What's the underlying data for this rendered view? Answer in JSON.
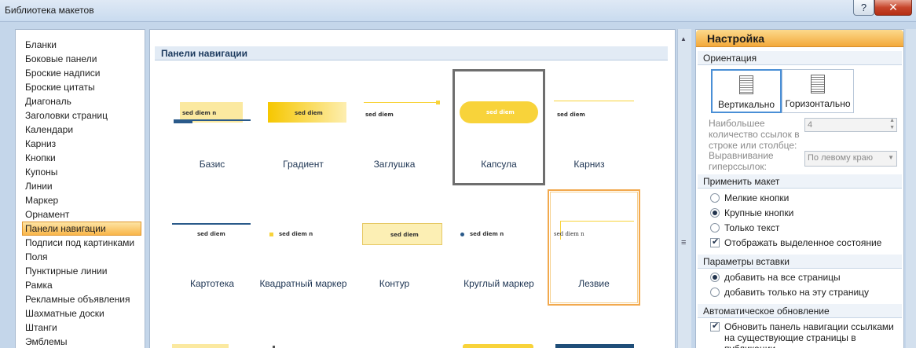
{
  "window": {
    "title": "Библиотека макетов",
    "help_glyph": "?",
    "close_glyph": "✕"
  },
  "categories": [
    "Бланки",
    "Боковые панели",
    "Броские надписи",
    "Броские цитаты",
    "Диагональ",
    "Заголовки страниц",
    "Календари",
    "Карниз",
    "Кнопки",
    "Купоны",
    "Линии",
    "Маркер",
    "Орнамент",
    "Панели навигации",
    "Подписи под картинками",
    "Поля",
    "Пунктирные линии",
    "Рамка",
    "Рекламные объявления",
    "Шахматные доски",
    "Штанги",
    "Эмблемы"
  ],
  "selected_category": "Панели навигации",
  "gallery": {
    "header": "Панели навигации",
    "sample_text": "sed diem",
    "sample_text_n": "sed diem n",
    "items": [
      "Базис",
      "Градиент",
      "Заглушка",
      "Капсула",
      "Карниз",
      "Картотека",
      "Квадратный маркер",
      "Контур",
      "Круглый маркер",
      "Лезвие"
    ],
    "selected_item": "Капсула",
    "hover_item": "Лезвие"
  },
  "settings": {
    "header": "Настройка",
    "orientation": {
      "title": "Ориентация",
      "vertical": "Вертикально",
      "horizontal": "Горизонтально",
      "selected": "Вертикально"
    },
    "max_links_label": "Наибольшее количество ссылок в строке или столбце:",
    "max_links_value": "4",
    "align_label": "Выравнивание гиперссылок:",
    "align_value": "По левому краю",
    "apply": {
      "title": "Применить макет",
      "small_buttons": "Мелкие кнопки",
      "large_buttons": "Крупные кнопки",
      "text_only": "Только текст",
      "show_selected": "Отображать выделенное состояние",
      "selected": "Крупные кнопки",
      "show_selected_checked": true
    },
    "insert": {
      "title": "Параметры вставки",
      "all_pages": "добавить на все страницы",
      "this_page": "добавить только на эту страницу",
      "selected": "добавить на все страницы"
    },
    "auto_update": {
      "title": "Автоматическое обновление",
      "update_nav": "Обновить панель навигации ссылками на существующие страницы в публикации",
      "checked": true
    }
  },
  "colors": {
    "accent_yellow": "#f8d33a",
    "nav_blue": "#2a5a8a",
    "selection_orange": "#f9b64a"
  }
}
